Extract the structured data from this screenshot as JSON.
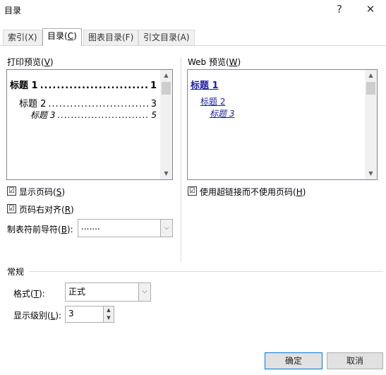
{
  "window": {
    "title": "目录",
    "help": "?",
    "close": "✕"
  },
  "tabs": [
    {
      "label": "索引(X)"
    },
    {
      "label_pre": "目录(",
      "label_key": "C",
      "label_post": ")"
    },
    {
      "label": "图表目录(F)"
    },
    {
      "label": "引文目录(A)"
    }
  ],
  "print_preview": {
    "label_pre": "打印预览(",
    "label_key": "V",
    "label_post": ")",
    "entries": [
      {
        "text": "标题 1",
        "page": "1"
      },
      {
        "text": "标题 2",
        "page": "3"
      },
      {
        "text": "标题 3",
        "page": "5"
      }
    ]
  },
  "web_preview": {
    "label_pre": "Web 预览(",
    "label_key": "W",
    "label_post": ")",
    "entries": [
      "标题 1",
      "标题 2",
      "标题 3"
    ]
  },
  "options": {
    "show_page_numbers": {
      "pre": "显示页码(",
      "key": "S",
      "post": ")",
      "checked": true,
      "mark": "☑"
    },
    "right_align": {
      "pre": "页码右对齐(",
      "key": "R",
      "post": ")",
      "checked": true,
      "mark": "☑"
    },
    "tab_leader": {
      "pre": "制表符前导符(",
      "key": "B",
      "post": "):",
      "value": "......."
    },
    "use_hyperlinks": {
      "pre": "使用超链接而不使用页码(",
      "key": "H",
      "post": ")",
      "checked": true,
      "mark": "☑"
    }
  },
  "general": {
    "label": "常规",
    "format": {
      "pre": "格式(",
      "key": "T",
      "post": "):",
      "value": "正式"
    },
    "levels": {
      "pre": "显示级别(",
      "key": "L",
      "post": "):",
      "value": "3"
    }
  },
  "buttons": {
    "ok": "确定",
    "cancel": "取消"
  },
  "glyphs": {
    "up": "▲",
    "down": "▼",
    "dropdown": "⌵"
  },
  "colors": {
    "link": "#2020a0",
    "focus": "#0078d7"
  }
}
